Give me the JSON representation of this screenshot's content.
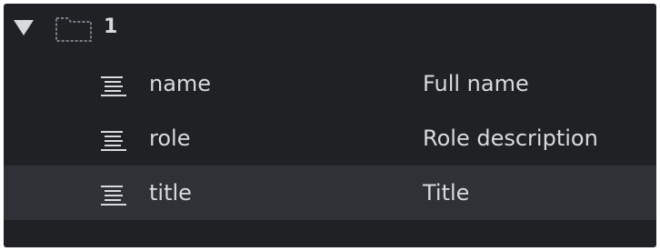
{
  "tree": {
    "root": {
      "label": "1",
      "expanded": true,
      "icon": "folder-icon"
    },
    "fields": [
      {
        "name": "name",
        "value": "Full name",
        "icon": "text-lines-icon"
      },
      {
        "name": "role",
        "value": "Role description",
        "icon": "text-lines-icon"
      },
      {
        "name": "title",
        "value": "Title",
        "icon": "text-lines-icon"
      }
    ]
  },
  "colors": {
    "panel_background": "#1f2125",
    "selected_row_background": "#2e3135",
    "text": "#d8dadc",
    "folder_outline": "#7b8086"
  }
}
